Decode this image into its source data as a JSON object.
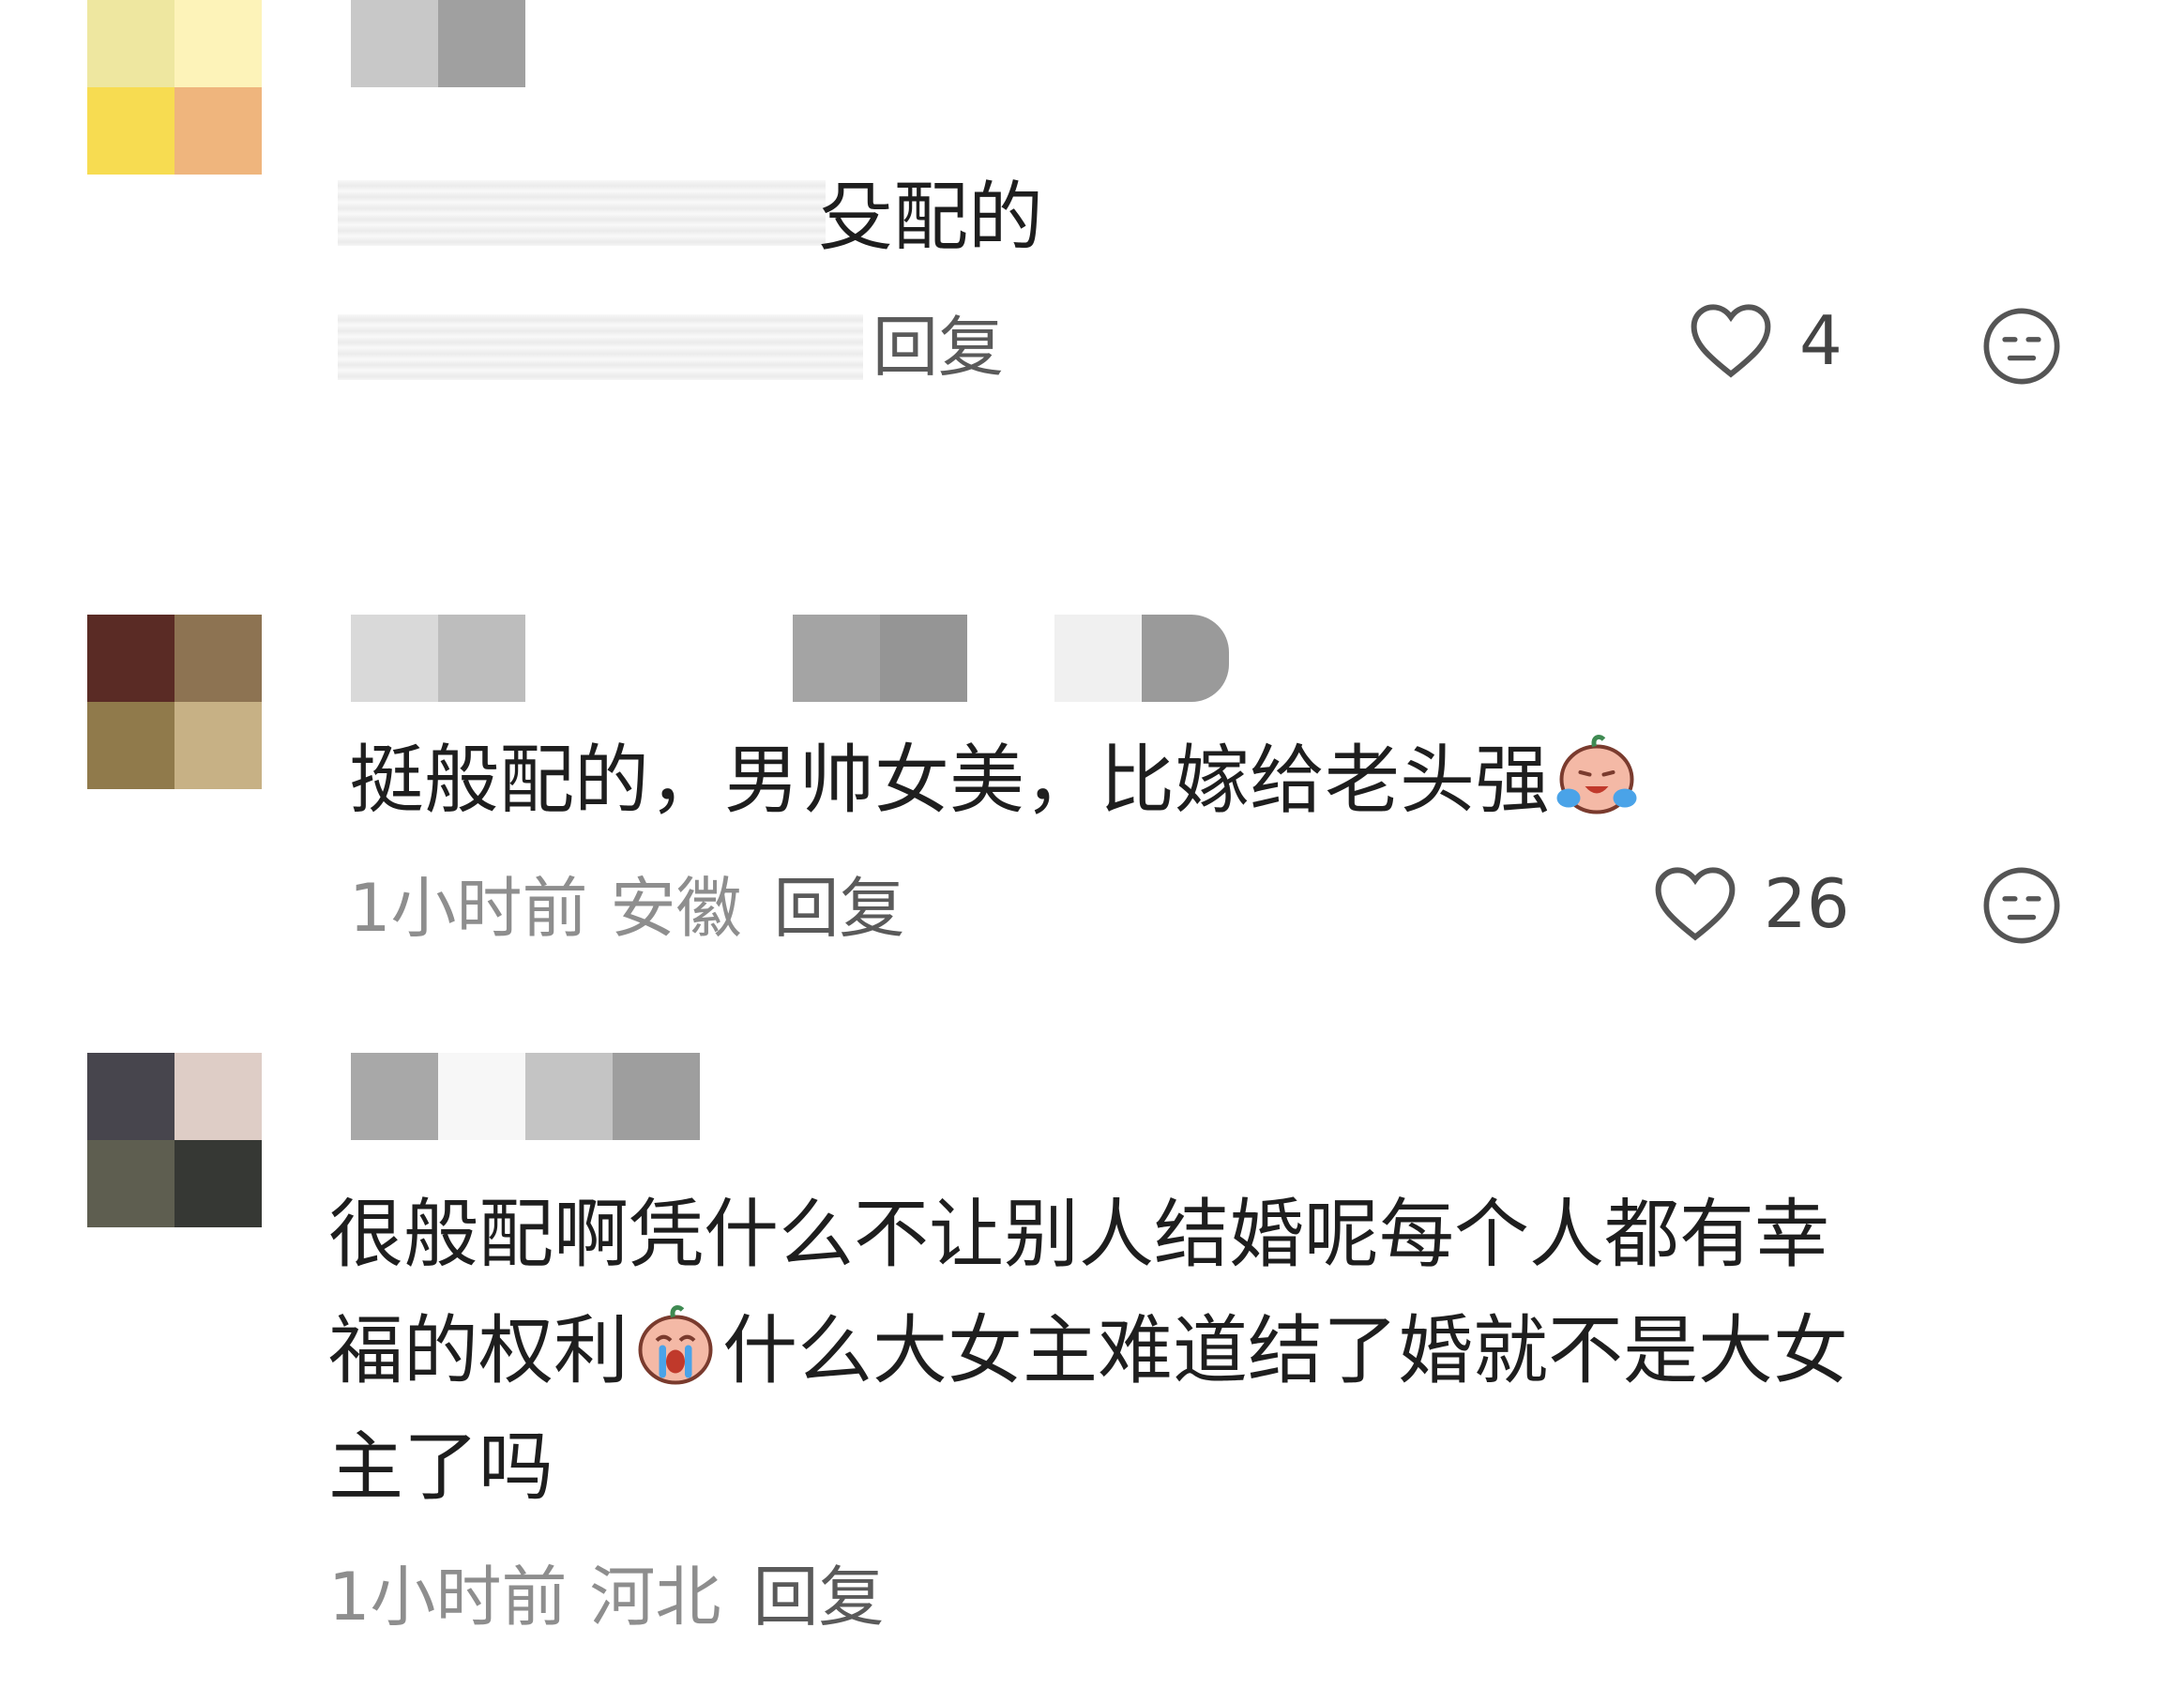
{
  "comments": [
    {
      "text_visible": "殳配的",
      "meta_visible": "回复",
      "likes": "4",
      "avatar_colors": [
        "#eee7a0",
        "#fdf3b9",
        "#f7dc51",
        "#efb57d"
      ],
      "name_colors": [
        "#c8c8c8",
        "#a0a0a0"
      ]
    },
    {
      "text": "挺般配的，男帅女美，比嫁给老头强",
      "time": "1小时前",
      "location": "安徽",
      "reply": "回复",
      "likes": "26",
      "avatar_colors": [
        "#5a2b25",
        "#8d7352",
        "#907a4b",
        "#c7b185"
      ],
      "name_colors": [
        "#d9d9d9",
        "#bdbdbd",
        "#a4a4a4",
        "#959595",
        "#f0f0f0",
        "#9a9a9a"
      ]
    },
    {
      "line1": "很般配啊凭什么不让别人结婚呢每个人都有幸",
      "line2a": "福的权利",
      "line2b": "什么大女主难道结了婚就不是大女",
      "line3": "主了吗",
      "time": "1小时前",
      "location": "河北",
      "reply": "回复",
      "avatar_colors": [
        "#47454d",
        "#decdc6",
        "#5e5e50",
        "#363834"
      ],
      "name_colors": [
        "#a8a8a8",
        "#f7f7f7",
        "#c4c4c4",
        "#9e9e9e"
      ]
    }
  ],
  "icons": {
    "like": "heart-outline-icon",
    "dislike": "neutral-face-icon",
    "emoji1": "laughing-crying-emoji",
    "emoji2": "crying-emoji"
  },
  "colors": {
    "text": "#1e1e1e",
    "meta": "#8e8e8e",
    "icon": "#555555"
  }
}
